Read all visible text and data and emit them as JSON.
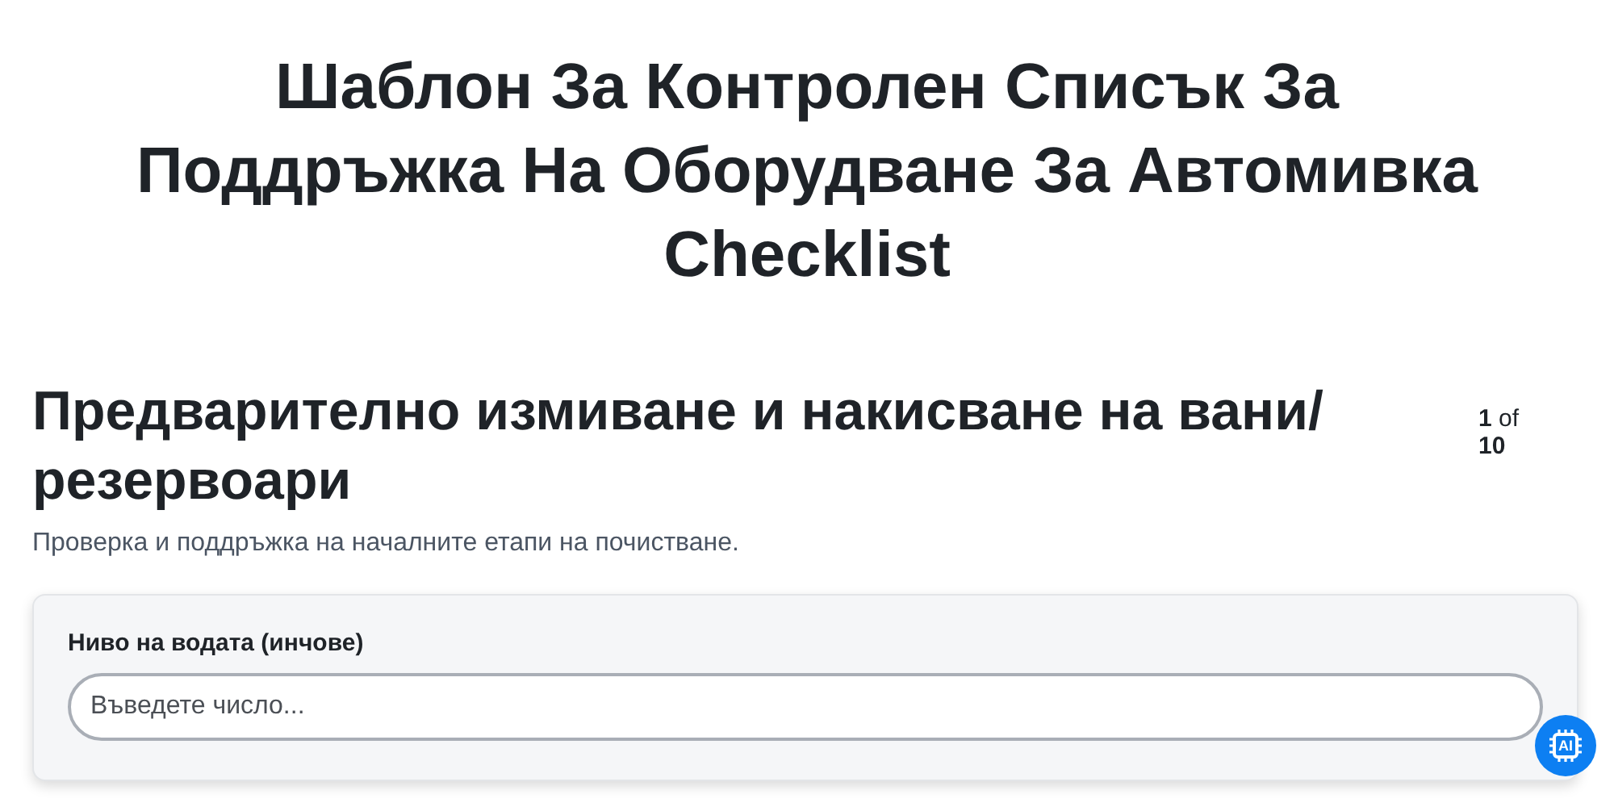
{
  "title": "Шаблон За Контролен Списък За Поддръжка На Оборудване За Автомивка Checklist",
  "section": {
    "heading": "Предварително измиване и накисване на вани/резервоари",
    "pager": "**1** of **10**",
    "description": "Проверка и поддръжка на началните етапи на почистване."
  },
  "fields": [
    {
      "kind": "number",
      "label": "Ниво на водата (инчове)",
      "placeholder": "Въведете число..."
    }
  ],
  "ai_button": {
    "label": "AI"
  }
}
